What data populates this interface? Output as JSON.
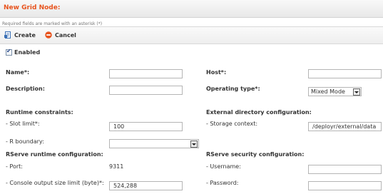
{
  "header": {
    "title": "New Grid Node:"
  },
  "required_note": "Required fields are marked with an asterisk (*)",
  "toolbar": {
    "create_label": "Create",
    "cancel_label": "Cancel"
  },
  "enabled": {
    "label": "Enabled",
    "checked": true
  },
  "form": {
    "name_label": "Name*:",
    "name_value": "",
    "host_label": "Host*:",
    "host_value": "",
    "description_label": "Description:",
    "description_value": "",
    "operating_type_label": "Operating type*:",
    "operating_type_value": "Mixed Mode",
    "runtime_heading": "Runtime constraints:",
    "external_heading": "External directory configuration:",
    "slot_limit_label": "- Slot limit*:",
    "slot_limit_value": "100",
    "storage_context_label": "- Storage context:",
    "storage_context_value": "/deployr/external/data",
    "r_boundary_label": "- R boundary:",
    "r_boundary_value": "",
    "rserve_runtime_heading": "RServe runtime configuration:",
    "rserve_security_heading": "RServe security configuration:",
    "port_label": "- Port:",
    "port_value": "9311",
    "username_label": "- Username:",
    "username_value": "",
    "console_limit_label": "- Console output size limit (byte)*:",
    "console_limit_value": "524,288",
    "password_label": "- Password:",
    "password_value": ""
  },
  "colors": {
    "title": "#e8541e",
    "cancel_icon": "#e8541e",
    "create_icon": "#3a6fb5"
  },
  "icons": {
    "create": "create-page-icon",
    "cancel": "cancel-circle-icon"
  }
}
